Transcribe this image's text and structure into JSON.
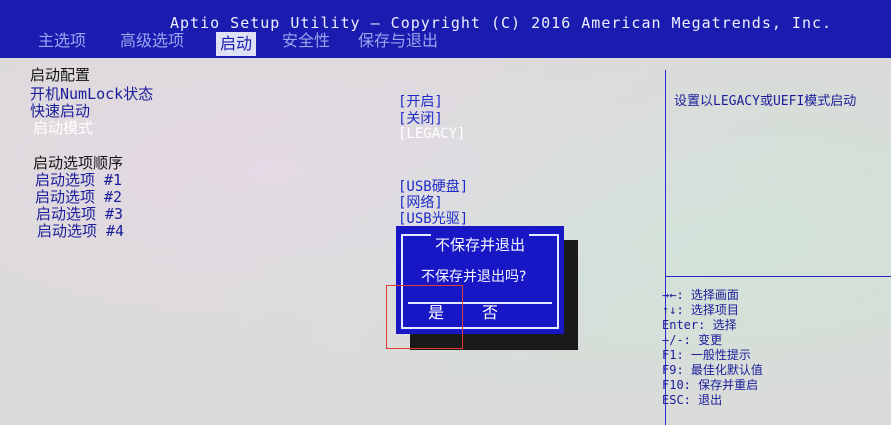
{
  "header": {
    "title": "Aptio Setup Utility – Copyright (C) 2016 American Megatrends, Inc.",
    "tabs": [
      "主选项",
      "高级选项",
      "启动",
      "安全性",
      "保存与退出"
    ],
    "active_tab": "启动"
  },
  "boot": {
    "section_config": "启动配置",
    "numlock_label": "开机NumLock状态",
    "numlock_value": "[开启]",
    "fastboot_label": "快速启动",
    "fastboot_value": "[关闭]",
    "mode_label": "启动模式",
    "mode_value": "[LEGACY]",
    "section_order": "启动选项顺序",
    "options": [
      {
        "label": "启动选项 #1",
        "value": "[USB硬盘]"
      },
      {
        "label": "启动选项 #2",
        "value": "[网络]"
      },
      {
        "label": "启动选项 #3",
        "value": "[USB光驱]"
      },
      {
        "label": "启动选项 #4",
        "value": ""
      }
    ]
  },
  "help": {
    "text": "设置以LEGACY或UEFI模式启动"
  },
  "keys": [
    "→←: 选择画面",
    "↑↓: 选择项目",
    "Enter: 选择",
    "+/-: 变更",
    "F1: 一般性提示",
    "F9: 最佳化默认值",
    "F10: 保存并重启",
    "ESC: 退出"
  ],
  "dialog": {
    "title": "不保存并退出",
    "message": "不保存并退出吗?",
    "yes": "是",
    "no": "否"
  },
  "colors": {
    "header_bg": "#1a1cb0",
    "dialog_bg": "#1717c6",
    "highlight": "#e23b2f"
  }
}
